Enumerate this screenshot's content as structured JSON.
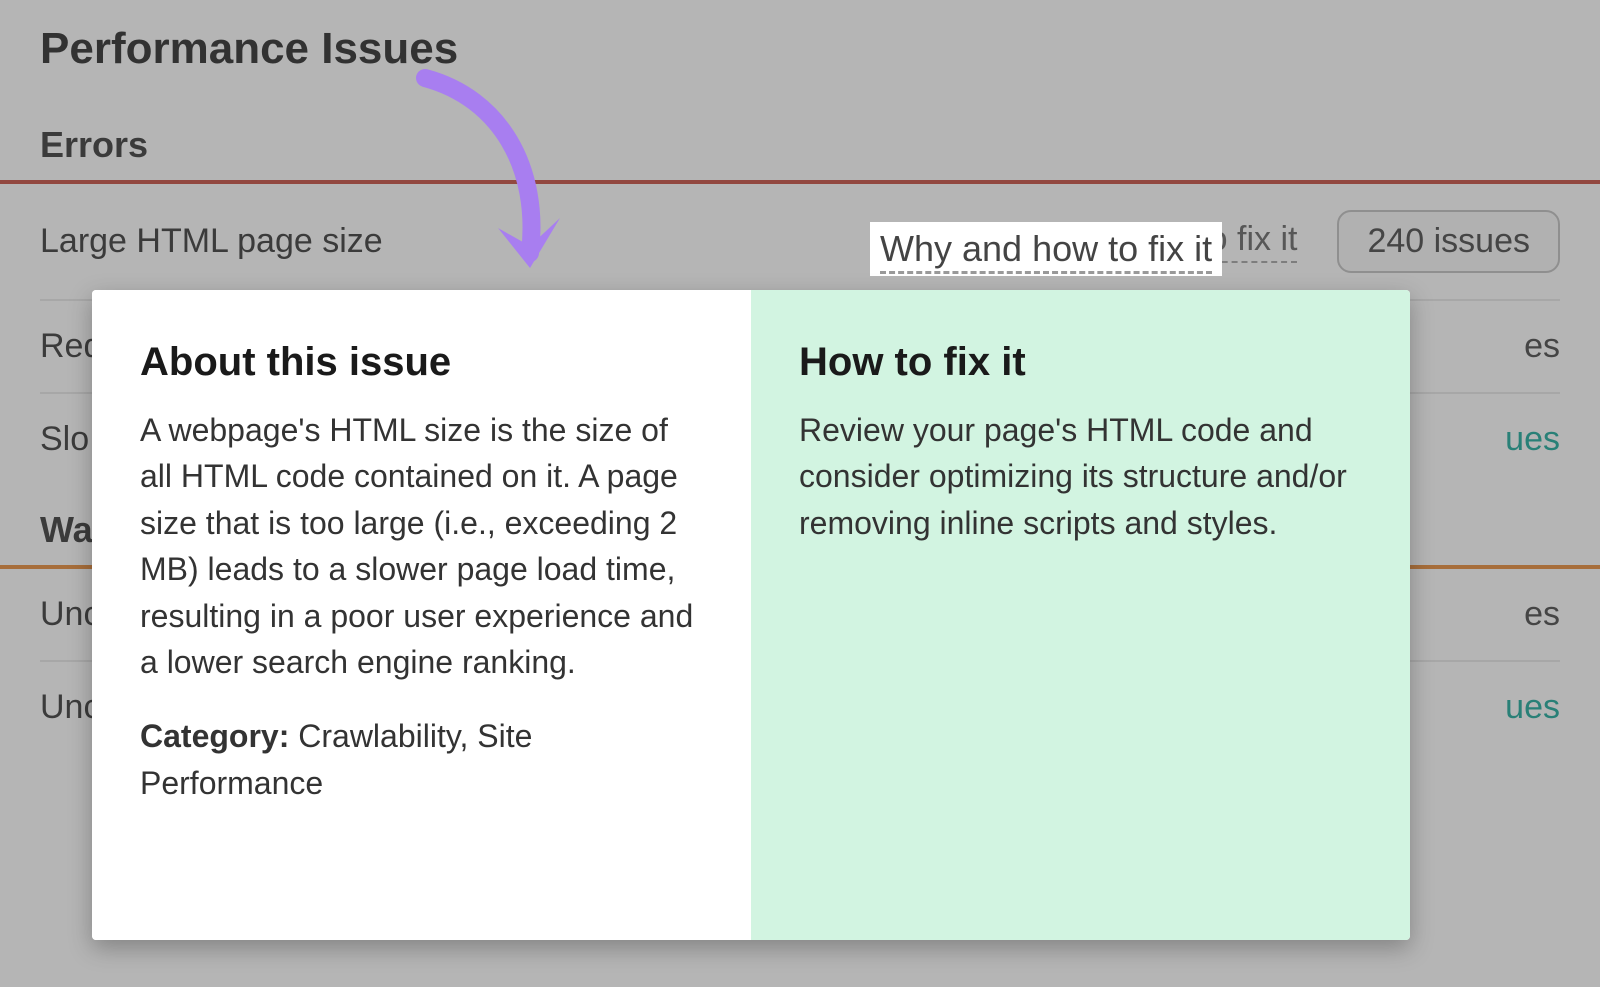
{
  "page": {
    "title": "Performance Issues"
  },
  "sections": {
    "errors_label": "Errors",
    "warnings_label": "Warnings"
  },
  "rows": {
    "r0": {
      "name": "Large HTML page size",
      "why": "Why and how to fix it",
      "count_text": "240 issues"
    },
    "r1": {
      "name_frag": "Red",
      "trail": "es"
    },
    "r2": {
      "name_frag": "Slo",
      "trail": "ues"
    },
    "r3": {
      "name_frag": "Unc",
      "trail": "es"
    },
    "r4": {
      "name_frag": "Unc",
      "trail": "ues"
    }
  },
  "why_highlight": "Why and how to fix it",
  "tooltip": {
    "about_heading": "About this issue",
    "about_body": "A webpage's HTML size is the size of all HTML code contained on it. A page size that is too large (i.e., exceeding 2 MB) leads to a slower page load time, resulting in a poor user experience and a lower search engine ranking.",
    "category_label": "Category:",
    "category_value": " Crawlability, Site Performance",
    "fix_heading": "How to fix it",
    "fix_body": "Review your page's HTML code and consider optimizing its structure and/or removing inline scripts and styles."
  }
}
